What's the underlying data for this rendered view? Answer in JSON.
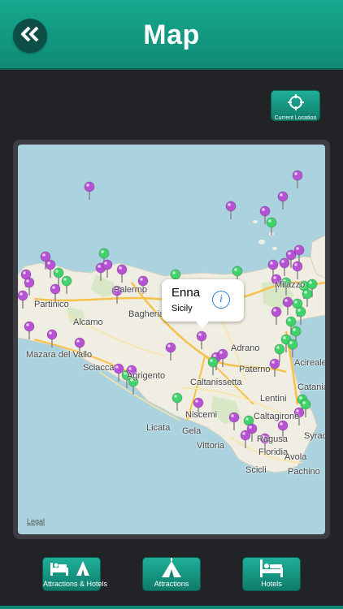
{
  "header": {
    "title": "Map",
    "back_icon": "double-chevron-left-icon"
  },
  "location_button": {
    "label": "Current Location",
    "icon": "crosshair-icon"
  },
  "map": {
    "places": [
      "Palermo",
      "Bagheria",
      "Partinico",
      "Alcamo",
      "Mazara del Vallo",
      "Sciacca",
      "Agrigento",
      "Licata",
      "Gela",
      "Vittoria",
      "Niscemi",
      "Caltanissetta",
      "Caltagirone",
      "Paterno",
      "Adrano",
      "Lentini",
      "Catania",
      "Acireale",
      "Milazzo",
      "Floridia",
      "Ragusa",
      "Avola",
      "Scicli",
      "Pachino",
      "Syracuse"
    ],
    "legal": "Legal",
    "callout": {
      "title": "Enna",
      "subtitle": "Sicily",
      "info_icon": "info-icon"
    },
    "pin_colors": {
      "attraction": "#b752d6",
      "hotel": "#3fd46a"
    }
  },
  "tabs": [
    {
      "label": "Attractions & Hotels",
      "icon": "bed-and-tent-icon"
    },
    {
      "label": "Attractions",
      "icon": "tent-icon"
    },
    {
      "label": "Hotels",
      "icon": "bed-icon"
    }
  ]
}
